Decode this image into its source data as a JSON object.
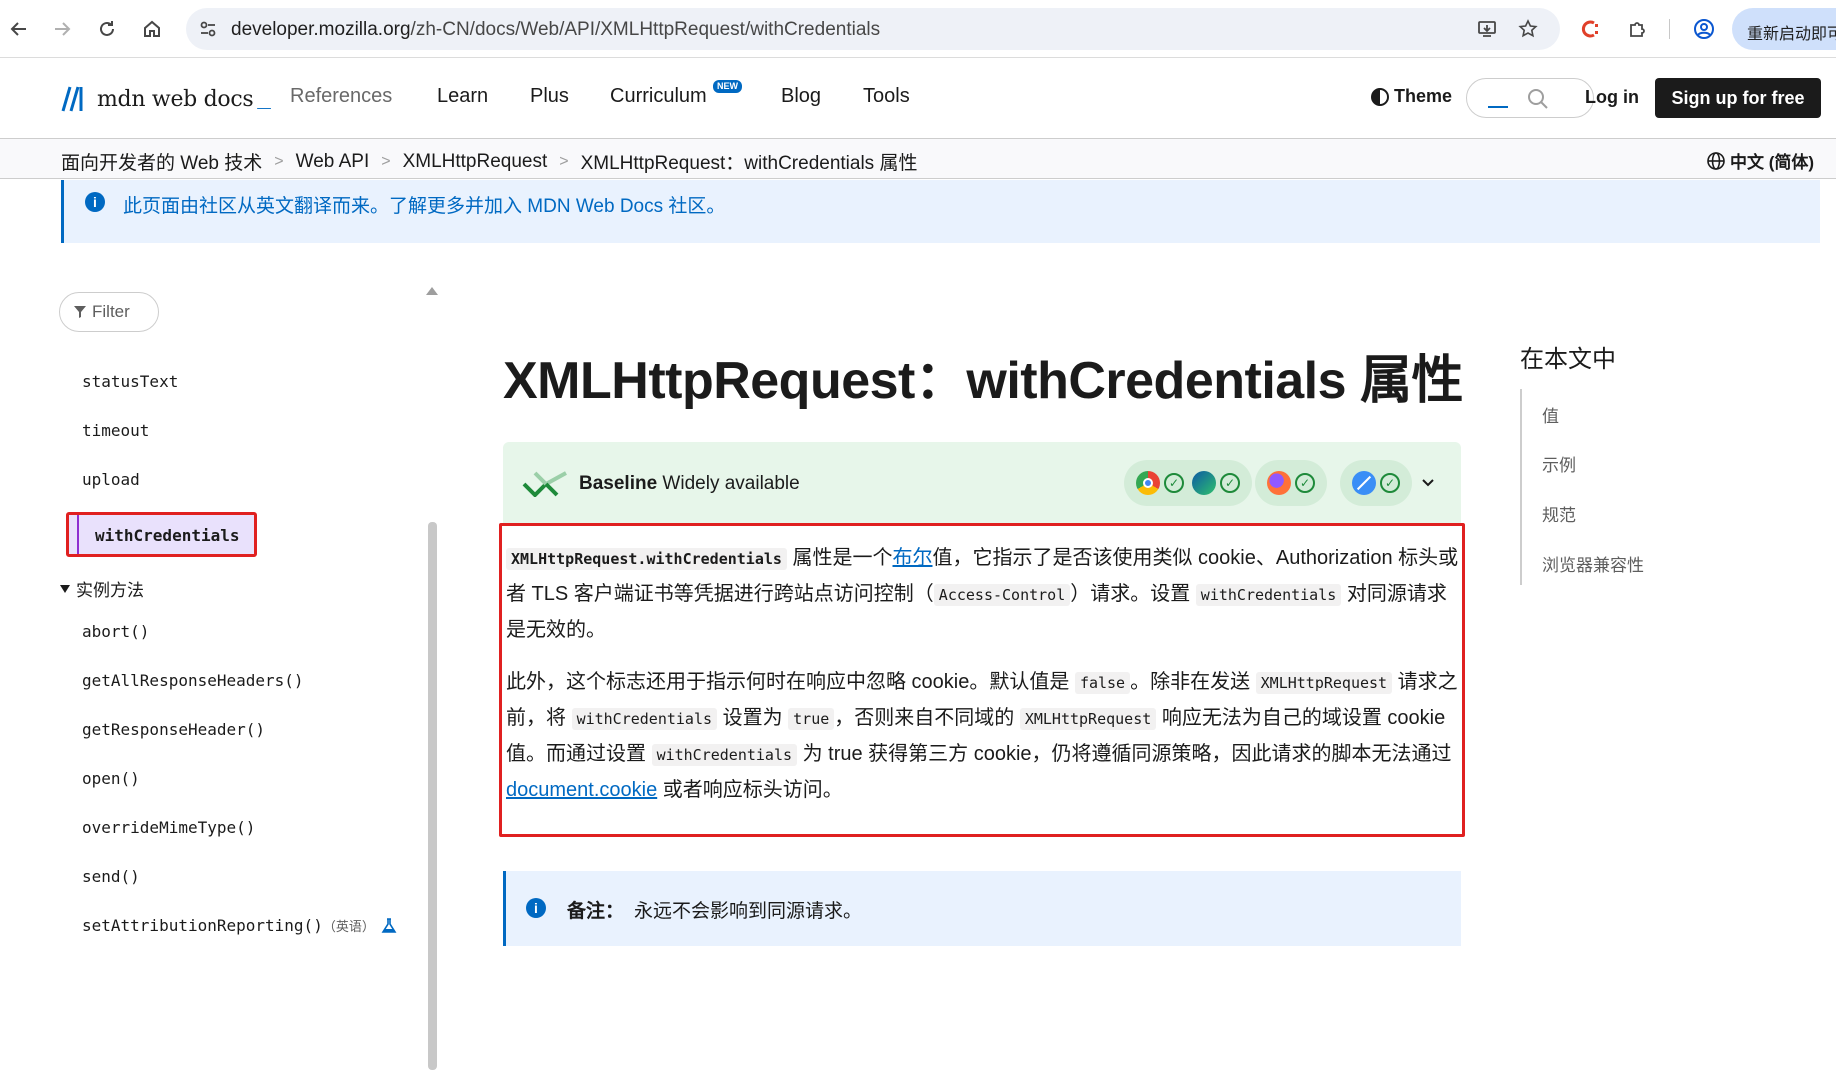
{
  "browser": {
    "url_domain": "developer.mozilla.org",
    "url_path": "/zh-CN/docs/Web/API/XMLHttpRequest/withCredentials",
    "restart_label": "重新启动即可"
  },
  "header": {
    "logo_text": "mdn web docs",
    "logo_underscore": "_",
    "nav": [
      "References",
      "Learn",
      "Plus",
      "Curriculum",
      "Blog",
      "Tools"
    ],
    "new_badge": "NEW",
    "theme_label": "Theme",
    "login_label": "Log in",
    "signup_label": "Sign up for free"
  },
  "breadcrumb": {
    "items": [
      "面向开发者的 Web 技术",
      "Web API",
      "XMLHttpRequest",
      "XMLHttpRequest：withCredentials 属性"
    ],
    "separator": ">",
    "language": "中文 (简体)"
  },
  "notice": {
    "text": "此页面由社区从英文翻译而来。了解更多并加入 MDN Web Docs 社区。"
  },
  "sidebar": {
    "filter_label": "Filter",
    "items_before": [
      "statusText",
      "timeout",
      "upload"
    ],
    "active_item": "withCredentials",
    "group_label": "实例方法",
    "methods": [
      "abort()",
      "getAllResponseHeaders()",
      "getResponseHeader()",
      "open()",
      "overrideMimeType()",
      "send()",
      "setAttributionReporting()"
    ],
    "last_suffix": "（英语）"
  },
  "toc": {
    "title": "在本文中",
    "items": [
      "值",
      "示例",
      "规范",
      "浏览器兼容性"
    ]
  },
  "article": {
    "title": "XMLHttpRequest：withCredentials 属性",
    "baseline_strong": "Baseline",
    "baseline_rest": " Widely available",
    "p1": {
      "code1": "XMLHttpRequest.withCredentials",
      "t1": " 属性是一个",
      "link1": "布尔",
      "t2": "值，它指示了是否该使用类似 cookie、Authorization 标头或者 TLS 客户端证书等凭据进行跨站点访问控制（",
      "code2": "Access-Control",
      "t3": "）请求。设置 ",
      "code3": "withCredentials",
      "t4": " 对同源请求是无效的。"
    },
    "p2": {
      "t1": "此外，这个标志还用于指示何时在响应中忽略 cookie。默认值是 ",
      "code1": "false",
      "t2": "。除非在发送 ",
      "code2": "XMLHttpRequest",
      "t3": " 请求之前，将 ",
      "code3": "withCredentials",
      "t4": " 设置为 ",
      "code4": "true",
      "t5": "，否则来自不同域的 ",
      "code5": "XMLHttpRequest",
      "t6": " 响应无法为自己的域设置 cookie 值。而通过设置 ",
      "code6": "withCredentials",
      "t7": " 为 true 获得第三方 cookie，仍将遵循同源策略，因此请求的脚本无法通过 ",
      "link1": "document.cookie",
      "t8": " 或者响应标头访问。"
    },
    "note_label": "备注：",
    "note_text": "永远不会影响到同源请求。"
  },
  "colors": {
    "accent": "#0069c2",
    "highlight_red": "#e02020",
    "baseline_green": "#1e8a3a",
    "active_purple": "#e9e1fc"
  }
}
